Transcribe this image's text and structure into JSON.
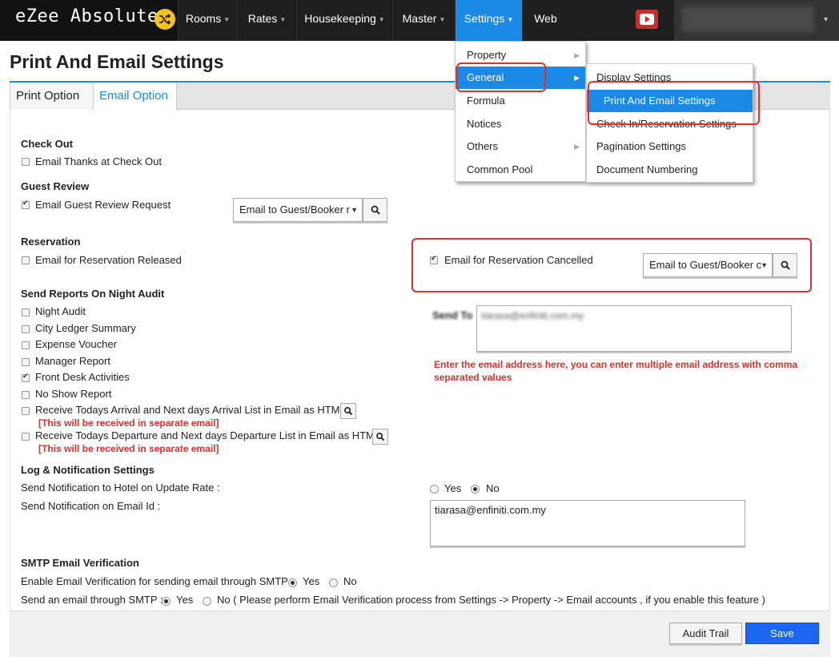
{
  "app": {
    "brand": "eZee Absolute"
  },
  "nav": {
    "items": [
      "Rooms",
      "Rates",
      "Housekeeping",
      "Master",
      "Settings",
      "Web"
    ],
    "active": "Settings"
  },
  "colors": {
    "accent": "#1a8ae6",
    "highlight_box": "#e52e2e",
    "warning_text": "#d9322e",
    "save_button": "#1b66f2",
    "brand_icon": "#f7c21e"
  },
  "settings_menu": {
    "items": [
      "Property",
      "General",
      "Formula",
      "Notices",
      "Others",
      "Common Pool"
    ]
  },
  "general_submenu": {
    "items": [
      "Display Settings",
      "Print And Email Settings",
      "Check In/Reservation Settings",
      "Pagination Settings",
      "Document Numbering"
    ]
  },
  "page": {
    "title": "Print And Email Settings"
  },
  "tabs": [
    "Print Option",
    "Email Option"
  ],
  "checkout": {
    "heading": "Check Out",
    "thanks_label": "Email Thanks at Check Out",
    "thanks_checked": false
  },
  "guest_review": {
    "heading": "Guest Review",
    "request_label": "Email Guest Review Request",
    "request_checked": true,
    "recipient_select": "Email to Guest/Booker r"
  },
  "reservation": {
    "heading": "Reservation",
    "released_label": "Email for Reservation Released",
    "released_checked": false,
    "cancelled_label": "Email for Reservation Cancelled",
    "cancelled_checked": true,
    "recipient_select": "Email to Guest/Booker c"
  },
  "night_audit": {
    "heading": "Send Reports On Night Audit",
    "items": [
      {
        "label": "Night Audit",
        "checked": false
      },
      {
        "label": "City Ledger Summary",
        "checked": false
      },
      {
        "label": "Expense Voucher",
        "checked": false
      },
      {
        "label": "Manager Report",
        "checked": false
      },
      {
        "label": "Front Desk Activities",
        "checked": true
      },
      {
        "label": "No Show Report",
        "checked": false
      },
      {
        "label": "Receive Todays Arrival and Next days Arrival List in Email as HTML",
        "checked": false
      },
      {
        "label": "Receive Todays Departure and Next days Departure List in Email as HTML",
        "checked": false
      }
    ],
    "separate_note": "[This will be received in separate email]",
    "send_to_label": "Send To",
    "send_to_value": "tiarasa@enfiniti.com.my",
    "email_hint_line1": "Enter the email address here, you can enter multiple email address with comma",
    "email_hint_line2": "separated values"
  },
  "log_notification": {
    "heading": "Log & Notification Settings",
    "update_rate_label": "Send Notification to Hotel on Update Rate :",
    "yes": "Yes",
    "no": "No",
    "update_rate_value": "No",
    "email_id_label": "Send Notification on Email Id :",
    "email_id_value": "tiarasa@enfiniti.com.my"
  },
  "smtp": {
    "heading": "SMTP Email Verification",
    "enable_label": "Enable Email Verification for sending email through SMTP :",
    "enable_value": "Yes",
    "send_label": "Send an email through SMTP :",
    "send_value": "Yes",
    "yes": "Yes",
    "no_note": "No ( Please perform Email Verification process from Settings -> Property -> Email accounts , if you enable this feature )",
    "no": "No"
  },
  "footer": {
    "audit_trail": "Audit Trail",
    "save": "Save"
  }
}
